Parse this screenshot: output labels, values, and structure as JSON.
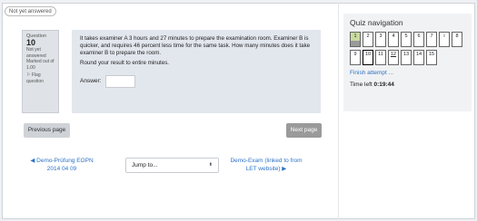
{
  "status_pill": "Not yet answered",
  "question": {
    "prefix": "Question",
    "number": "10",
    "status": "Not yet answered",
    "marks": "Marked out of 1.00",
    "flag": "Flag question",
    "text": "It takes examiner A 3 hours and 27 minutes to prepare the examination room. Examiner B is quicker, and requires 46 percent less time for the same task. How many minutes does it take examiner B to prepare the room.",
    "instruction": "Round your result to entire minutes.",
    "answer_label": "Answer:",
    "answer_value": ""
  },
  "buttons": {
    "previous": "Previous page",
    "next": "Next page"
  },
  "navigation": {
    "prev_link": "◀ Demo-Prüfung EOPN 2014 04 09",
    "jump_placeholder": "Jump to...",
    "jump_arrow": "⬍",
    "next_link": "Demo-Exam (linked to from LET website) ▶"
  },
  "quiz_nav": {
    "title": "Quiz navigation",
    "items": [
      "1",
      "2",
      "3",
      "4",
      "5",
      "6",
      "7",
      "i",
      "8",
      "9",
      "10",
      "11",
      "12",
      "13",
      "14",
      "15"
    ],
    "finish": "Finish attempt ...",
    "time_label": "Time left",
    "time_value": "0:19:44"
  }
}
